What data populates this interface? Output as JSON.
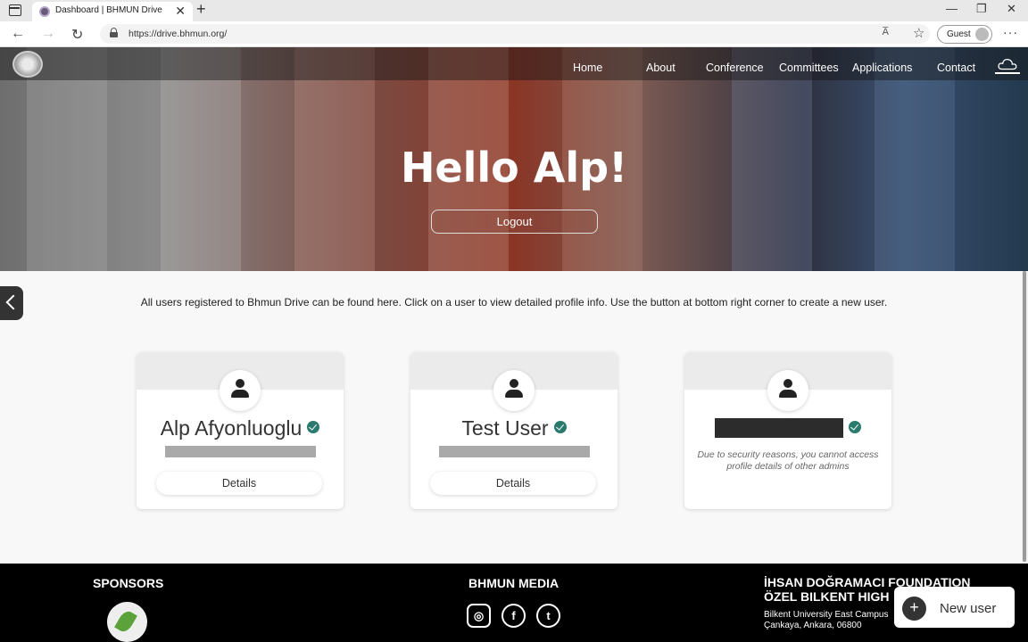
{
  "browser": {
    "tab_title": "Dashboard | BHMUN Drive",
    "tab_close": "✕",
    "new_tab": "+",
    "url": "https://drive.bhmun.org/",
    "read_aloud": "A̅",
    "guest_label": "Guest",
    "more": "···",
    "window_controls": [
      "—",
      "❐",
      "✕"
    ],
    "nav_icons": [
      "←",
      "→",
      "↻"
    ]
  },
  "site": {
    "nav": [
      "Home",
      "About",
      "Conference",
      "Committees",
      "Applications",
      "Contact"
    ],
    "greeting": "Hello Alp!",
    "logout_label": "Logout"
  },
  "main": {
    "intro": "All users registered to Bhmun Drive can be found here. Click on a user to view detailed profile info. Use the button at bottom right corner to create a new user.",
    "users": [
      {
        "name": "Alp Afyonluoglu",
        "verified": true,
        "details_label": "Details"
      },
      {
        "name": "Test User",
        "verified": true,
        "details_label": "Details"
      },
      {
        "name": "",
        "verified": true,
        "notice": "Due to security reasons, you cannot access profile details of other admins"
      }
    ]
  },
  "footer": {
    "sponsors_heading": "SPONSORS",
    "media_heading": "BHMUN MEDIA",
    "social_icons": [
      "instagram-icon",
      "facebook-icon",
      "twitter-icon"
    ],
    "foundation_line1": "İHSAN DOĞRAMACI FOUNDATION",
    "foundation_line2": "ÖZEL BILKENT HIGH",
    "address_line1": "Bilkent University East Campus",
    "address_line2": "Çankaya, Ankara, 06800"
  },
  "fab": {
    "label": "New user",
    "plus": "+"
  }
}
